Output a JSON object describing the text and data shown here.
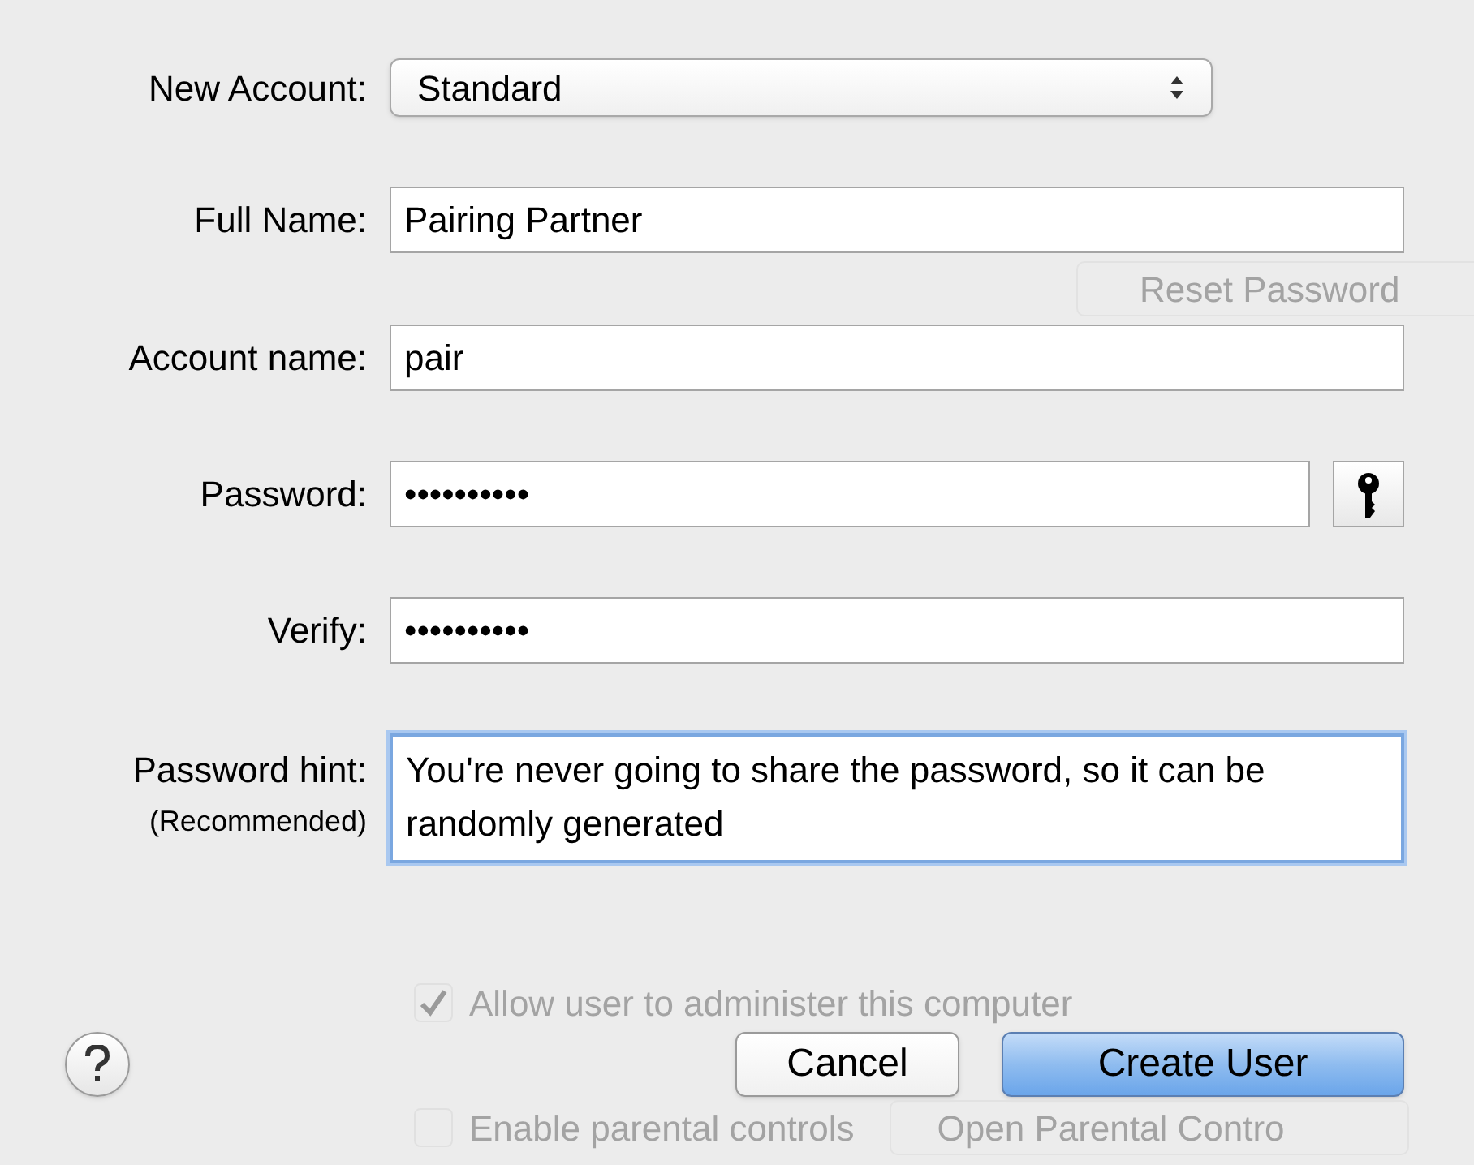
{
  "new_account": {
    "label": "New Account:",
    "value": "Standard"
  },
  "fields": [
    {
      "label": "Full Name:",
      "value": "Pairing Partner",
      "kind": "text"
    },
    {
      "label": "Account name:",
      "value": "pair",
      "kind": "text"
    },
    {
      "label": "Password:",
      "value": "••••••••••",
      "kind": "password"
    },
    {
      "label": "Verify:",
      "value": "••••••••••",
      "kind": "text"
    }
  ],
  "hint": {
    "label": "Password hint:",
    "note": "(Recommended)",
    "value": "You're never going to share the password, so it can be randomly generated",
    "focused": true
  },
  "background": {
    "reset_button": "Reset Password",
    "checkboxes": [
      {
        "label": "Allow user to administer this computer",
        "checked": true
      },
      {
        "label": "Enable parental controls",
        "checked": false
      }
    ],
    "parental_button": "Open Parental Contro"
  },
  "buttons": [
    {
      "label": "Cancel",
      "kind": "cancel"
    },
    {
      "label": "Create User",
      "kind": "default"
    }
  ]
}
